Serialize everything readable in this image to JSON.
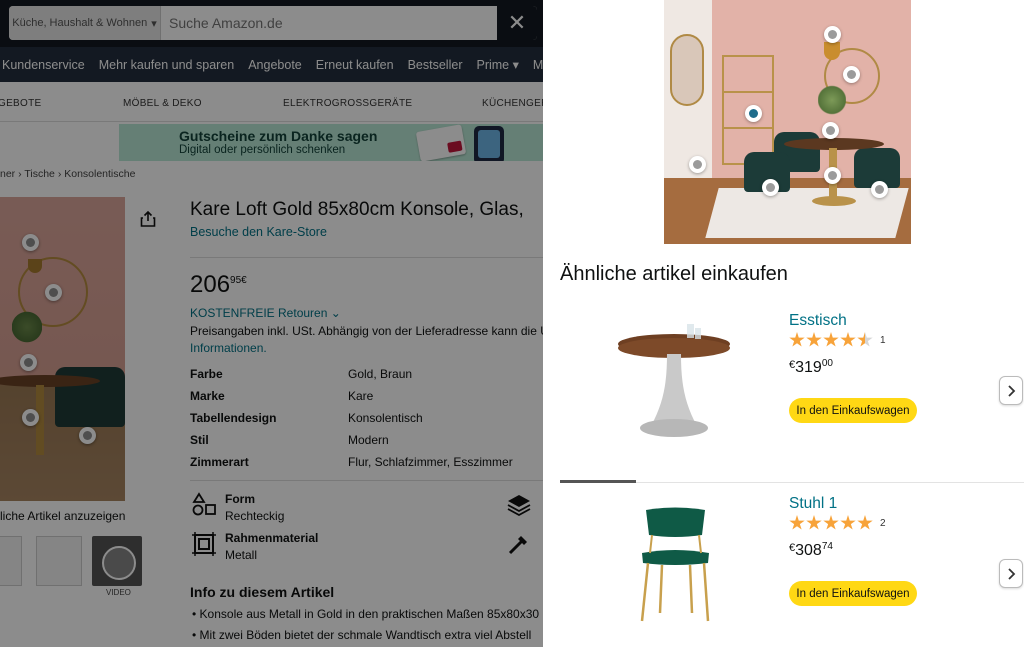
{
  "search": {
    "category": "Küche, Haushalt & Wohnen",
    "placeholder": "Suche Amazon.de",
    "clear_symbol": "✕"
  },
  "nav": [
    "Kundenservice",
    "Mehr kaufen und sparen",
    "Angebote",
    "Erneut kaufen",
    "Bestseller",
    "Prime ▾",
    "Mus"
  ],
  "categories": [
    "GEBOTE",
    "MÖBEL & DEKO",
    "ELEKTROGROSSGERÄTE",
    "KÜCHENGER"
  ],
  "banner": {
    "title": "Gutscheine zum Danke sagen",
    "subtitle": "Digital oder persönlich schenken"
  },
  "breadcrumb": [
    "ner",
    "Tische",
    "Konsolentische"
  ],
  "product": {
    "title": "Kare Loft Gold 85x80cm Konsole, Glas,",
    "store_link": "Besuche den Kare-Store",
    "price_main": "206",
    "price_cents": "95",
    "currency": "€",
    "returns": "KOSTENFREIE Retouren ⌄",
    "vat_text": "Preisangaben inkl. USt. Abhängig von der Lieferadresse kann die U",
    "vat_link": "Informationen.",
    "specs": [
      {
        "key": "Farbe",
        "value": "Gold, Braun"
      },
      {
        "key": "Marke",
        "value": "Kare"
      },
      {
        "key": "Tabellendesign",
        "value": "Konsolentisch"
      },
      {
        "key": "Stil",
        "value": "Modern"
      },
      {
        "key": "Zimmerart",
        "value": "Flur, Schlafzimmer, Esszimmer"
      }
    ],
    "features": [
      {
        "label": "Form",
        "value": "Rechteckig",
        "icon": "shapes-icon"
      },
      {
        "label": "Rahmenmaterial",
        "value": "Metall",
        "icon": "frame-icon"
      }
    ],
    "similar_label": "liche Artikel anzuzeigen",
    "video_label": "VIDEO",
    "about_title": "Info zu diesem Artikel",
    "bullets": [
      "Konsole aus Metall in Gold in den praktischen Maßen 85x80x30",
      "Mit zwei Böden bietet der schmale Wandtisch extra viel Abstell"
    ]
  },
  "panel": {
    "section_title": "Ähnliche artikel einkaufen",
    "items": [
      {
        "name": "Esstisch",
        "rating": 4.5,
        "review_count": "1",
        "currency": "€",
        "price_main": "319",
        "price_cents": "00",
        "cart_label": "In den Einkaufswagen"
      },
      {
        "name": "Stuhl 1",
        "rating": 5,
        "review_count": "2",
        "currency": "€",
        "price_main": "308",
        "price_cents": "74",
        "cart_label": "In den Einkaufswagen"
      }
    ]
  },
  "colors": {
    "amazon_dark": "#131921",
    "nav_blue": "#232f3e",
    "link_teal": "#007185",
    "star_orange": "#f7a33a",
    "cart_yellow": "#ffd814"
  }
}
